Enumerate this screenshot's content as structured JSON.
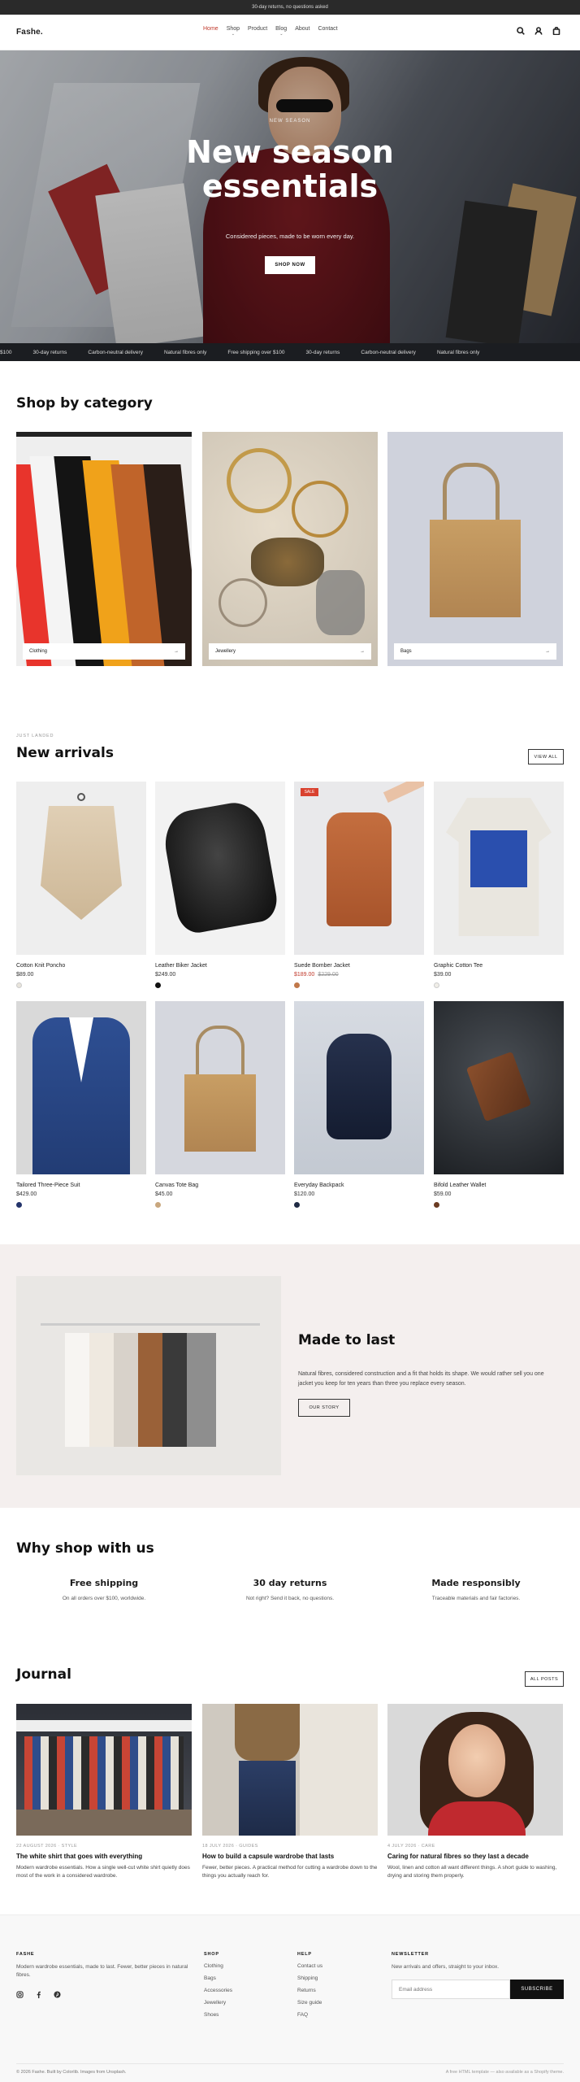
{
  "topbar": {
    "text": "30-day returns, no questions asked"
  },
  "header": {
    "logo": "Fashe.",
    "nav": [
      {
        "label": "Home",
        "active": true
      },
      {
        "label": "Shop",
        "caret": true
      },
      {
        "label": "Product"
      },
      {
        "label": "Blog",
        "caret": true
      },
      {
        "label": "About"
      },
      {
        "label": "Contact"
      }
    ],
    "icons": [
      "search-icon",
      "user-icon",
      "bag-icon"
    ]
  },
  "hero": {
    "eyebrow": "NEW SEASON",
    "title_line1": "New season",
    "title_line2": "essentials",
    "subtitle": "Considered pieces, made to be worn every day.",
    "button": "SHOP NOW"
  },
  "ticker": {
    "items": [
      "$100",
      "30-day returns",
      "Carbon-neutral delivery",
      "Natural fibres only",
      "Free shipping over $100",
      "30-day returns",
      "Carbon-neutral delivery",
      "Natural fibres only"
    ]
  },
  "categories": {
    "title": "Shop by category",
    "items": [
      {
        "label": "Clothing"
      },
      {
        "label": "Jewellery"
      },
      {
        "label": "Bags"
      }
    ],
    "arrow": "→"
  },
  "arrivals": {
    "eyebrow": "JUST LANDED",
    "title": "New arrivals",
    "view_all": "VIEW ALL",
    "sale_badge": "SALE",
    "products": [
      {
        "name": "Cotton Knit Poncho",
        "price": "$89.00",
        "swatch": "#e8e4dc"
      },
      {
        "name": "Leather Biker Jacket",
        "price": "$249.00",
        "swatch": "#111111"
      },
      {
        "name": "Suede Bomber Jacket",
        "price": "$189.00",
        "was": "$229.00",
        "swatch": "#c1784a",
        "sale": true
      },
      {
        "name": "Graphic Cotton Tee",
        "price": "$39.00",
        "swatch": "#f0eee8"
      },
      {
        "name": "Tailored Three-Piece Suit",
        "price": "$429.00",
        "swatch": "#24346b"
      },
      {
        "name": "Canvas Tote Bag",
        "price": "$45.00",
        "swatch": "#c9a77e"
      },
      {
        "name": "Everyday Backpack",
        "price": "$120.00",
        "swatch": "#1f2a44"
      },
      {
        "name": "Bifold Leather Wallet",
        "price": "$59.00",
        "swatch": "#6b3b22"
      }
    ]
  },
  "story": {
    "title": "Made to last",
    "text": "Natural fibres, considered construction and a fit that holds its shape. We would rather sell you one jacket you keep for ten years than three you replace every season.",
    "button": "OUR STORY"
  },
  "why": {
    "title": "Why shop with us",
    "features": [
      {
        "title": "Free shipping",
        "sub": "On all orders over $100, worldwide."
      },
      {
        "title": "30 day returns",
        "sub": "Not right? Send it back, no questions."
      },
      {
        "title": "Made responsibly",
        "sub": "Traceable materials and fair factories."
      }
    ]
  },
  "journal": {
    "title": "Journal",
    "all_posts": "ALL POSTS",
    "posts": [
      {
        "meta": "22 AUGUST 2026 · STYLE",
        "title": "The white shirt that goes with everything",
        "text": "Modern wardrobe essentials. How a single well-cut white shirt quietly does most of the work in a considered wardrobe."
      },
      {
        "meta": "18 JULY 2026 · GUIDES",
        "title": "How to build a capsule wardrobe that lasts",
        "text": "Fewer, better pieces. A practical method for cutting a wardrobe down to the things you actually reach for."
      },
      {
        "meta": "4 JULY 2026 · CARE",
        "title": "Caring for natural fibres so they last a decade",
        "text": "Wool, linen and cotton all want different things. A short guide to washing, drying and storing them properly."
      }
    ]
  },
  "footer": {
    "brand_head": "FASHE",
    "brand_text": "Modern wardrobe essentials, made to last. Fewer, better pieces in natural fibres.",
    "shop_head": "SHOP",
    "shop_links": [
      "Clothing",
      "Bags",
      "Accessories",
      "Jewellery",
      "Shoes"
    ],
    "help_head": "HELP",
    "help_links": [
      "Contact us",
      "Shipping",
      "Returns",
      "Size guide",
      "FAQ"
    ],
    "news_head": "NEWSLETTER",
    "news_text": "New arrivals and offers, straight to your inbox.",
    "email_placeholder": "Email address",
    "subscribe": "SUBSCRIBE",
    "social": [
      "instagram-icon",
      "facebook-icon",
      "pinterest-icon"
    ],
    "copyright": "© 2026 Fashe. Built by Colorlib. Images from Unsplash.",
    "credit": "A free HTML template — also available as a Shopify theme."
  }
}
